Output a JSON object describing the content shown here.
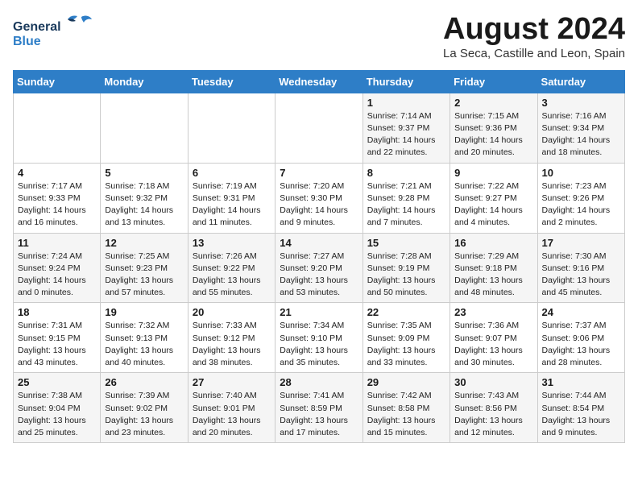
{
  "header": {
    "logo_line1": "General",
    "logo_line2": "Blue",
    "month": "August 2024",
    "location": "La Seca, Castille and Leon, Spain"
  },
  "weekdays": [
    "Sunday",
    "Monday",
    "Tuesday",
    "Wednesday",
    "Thursday",
    "Friday",
    "Saturday"
  ],
  "weeks": [
    [
      {
        "day": "",
        "info": ""
      },
      {
        "day": "",
        "info": ""
      },
      {
        "day": "",
        "info": ""
      },
      {
        "day": "",
        "info": ""
      },
      {
        "day": "1",
        "info": "Sunrise: 7:14 AM\nSunset: 9:37 PM\nDaylight: 14 hours\nand 22 minutes."
      },
      {
        "day": "2",
        "info": "Sunrise: 7:15 AM\nSunset: 9:36 PM\nDaylight: 14 hours\nand 20 minutes."
      },
      {
        "day": "3",
        "info": "Sunrise: 7:16 AM\nSunset: 9:34 PM\nDaylight: 14 hours\nand 18 minutes."
      }
    ],
    [
      {
        "day": "4",
        "info": "Sunrise: 7:17 AM\nSunset: 9:33 PM\nDaylight: 14 hours\nand 16 minutes."
      },
      {
        "day": "5",
        "info": "Sunrise: 7:18 AM\nSunset: 9:32 PM\nDaylight: 14 hours\nand 13 minutes."
      },
      {
        "day": "6",
        "info": "Sunrise: 7:19 AM\nSunset: 9:31 PM\nDaylight: 14 hours\nand 11 minutes."
      },
      {
        "day": "7",
        "info": "Sunrise: 7:20 AM\nSunset: 9:30 PM\nDaylight: 14 hours\nand 9 minutes."
      },
      {
        "day": "8",
        "info": "Sunrise: 7:21 AM\nSunset: 9:28 PM\nDaylight: 14 hours\nand 7 minutes."
      },
      {
        "day": "9",
        "info": "Sunrise: 7:22 AM\nSunset: 9:27 PM\nDaylight: 14 hours\nand 4 minutes."
      },
      {
        "day": "10",
        "info": "Sunrise: 7:23 AM\nSunset: 9:26 PM\nDaylight: 14 hours\nand 2 minutes."
      }
    ],
    [
      {
        "day": "11",
        "info": "Sunrise: 7:24 AM\nSunset: 9:24 PM\nDaylight: 14 hours\nand 0 minutes."
      },
      {
        "day": "12",
        "info": "Sunrise: 7:25 AM\nSunset: 9:23 PM\nDaylight: 13 hours\nand 57 minutes."
      },
      {
        "day": "13",
        "info": "Sunrise: 7:26 AM\nSunset: 9:22 PM\nDaylight: 13 hours\nand 55 minutes."
      },
      {
        "day": "14",
        "info": "Sunrise: 7:27 AM\nSunset: 9:20 PM\nDaylight: 13 hours\nand 53 minutes."
      },
      {
        "day": "15",
        "info": "Sunrise: 7:28 AM\nSunset: 9:19 PM\nDaylight: 13 hours\nand 50 minutes."
      },
      {
        "day": "16",
        "info": "Sunrise: 7:29 AM\nSunset: 9:18 PM\nDaylight: 13 hours\nand 48 minutes."
      },
      {
        "day": "17",
        "info": "Sunrise: 7:30 AM\nSunset: 9:16 PM\nDaylight: 13 hours\nand 45 minutes."
      }
    ],
    [
      {
        "day": "18",
        "info": "Sunrise: 7:31 AM\nSunset: 9:15 PM\nDaylight: 13 hours\nand 43 minutes."
      },
      {
        "day": "19",
        "info": "Sunrise: 7:32 AM\nSunset: 9:13 PM\nDaylight: 13 hours\nand 40 minutes."
      },
      {
        "day": "20",
        "info": "Sunrise: 7:33 AM\nSunset: 9:12 PM\nDaylight: 13 hours\nand 38 minutes."
      },
      {
        "day": "21",
        "info": "Sunrise: 7:34 AM\nSunset: 9:10 PM\nDaylight: 13 hours\nand 35 minutes."
      },
      {
        "day": "22",
        "info": "Sunrise: 7:35 AM\nSunset: 9:09 PM\nDaylight: 13 hours\nand 33 minutes."
      },
      {
        "day": "23",
        "info": "Sunrise: 7:36 AM\nSunset: 9:07 PM\nDaylight: 13 hours\nand 30 minutes."
      },
      {
        "day": "24",
        "info": "Sunrise: 7:37 AM\nSunset: 9:06 PM\nDaylight: 13 hours\nand 28 minutes."
      }
    ],
    [
      {
        "day": "25",
        "info": "Sunrise: 7:38 AM\nSunset: 9:04 PM\nDaylight: 13 hours\nand 25 minutes."
      },
      {
        "day": "26",
        "info": "Sunrise: 7:39 AM\nSunset: 9:02 PM\nDaylight: 13 hours\nand 23 minutes."
      },
      {
        "day": "27",
        "info": "Sunrise: 7:40 AM\nSunset: 9:01 PM\nDaylight: 13 hours\nand 20 minutes."
      },
      {
        "day": "28",
        "info": "Sunrise: 7:41 AM\nSunset: 8:59 PM\nDaylight: 13 hours\nand 17 minutes."
      },
      {
        "day": "29",
        "info": "Sunrise: 7:42 AM\nSunset: 8:58 PM\nDaylight: 13 hours\nand 15 minutes."
      },
      {
        "day": "30",
        "info": "Sunrise: 7:43 AM\nSunset: 8:56 PM\nDaylight: 13 hours\nand 12 minutes."
      },
      {
        "day": "31",
        "info": "Sunrise: 7:44 AM\nSunset: 8:54 PM\nDaylight: 13 hours\nand 9 minutes."
      }
    ]
  ]
}
